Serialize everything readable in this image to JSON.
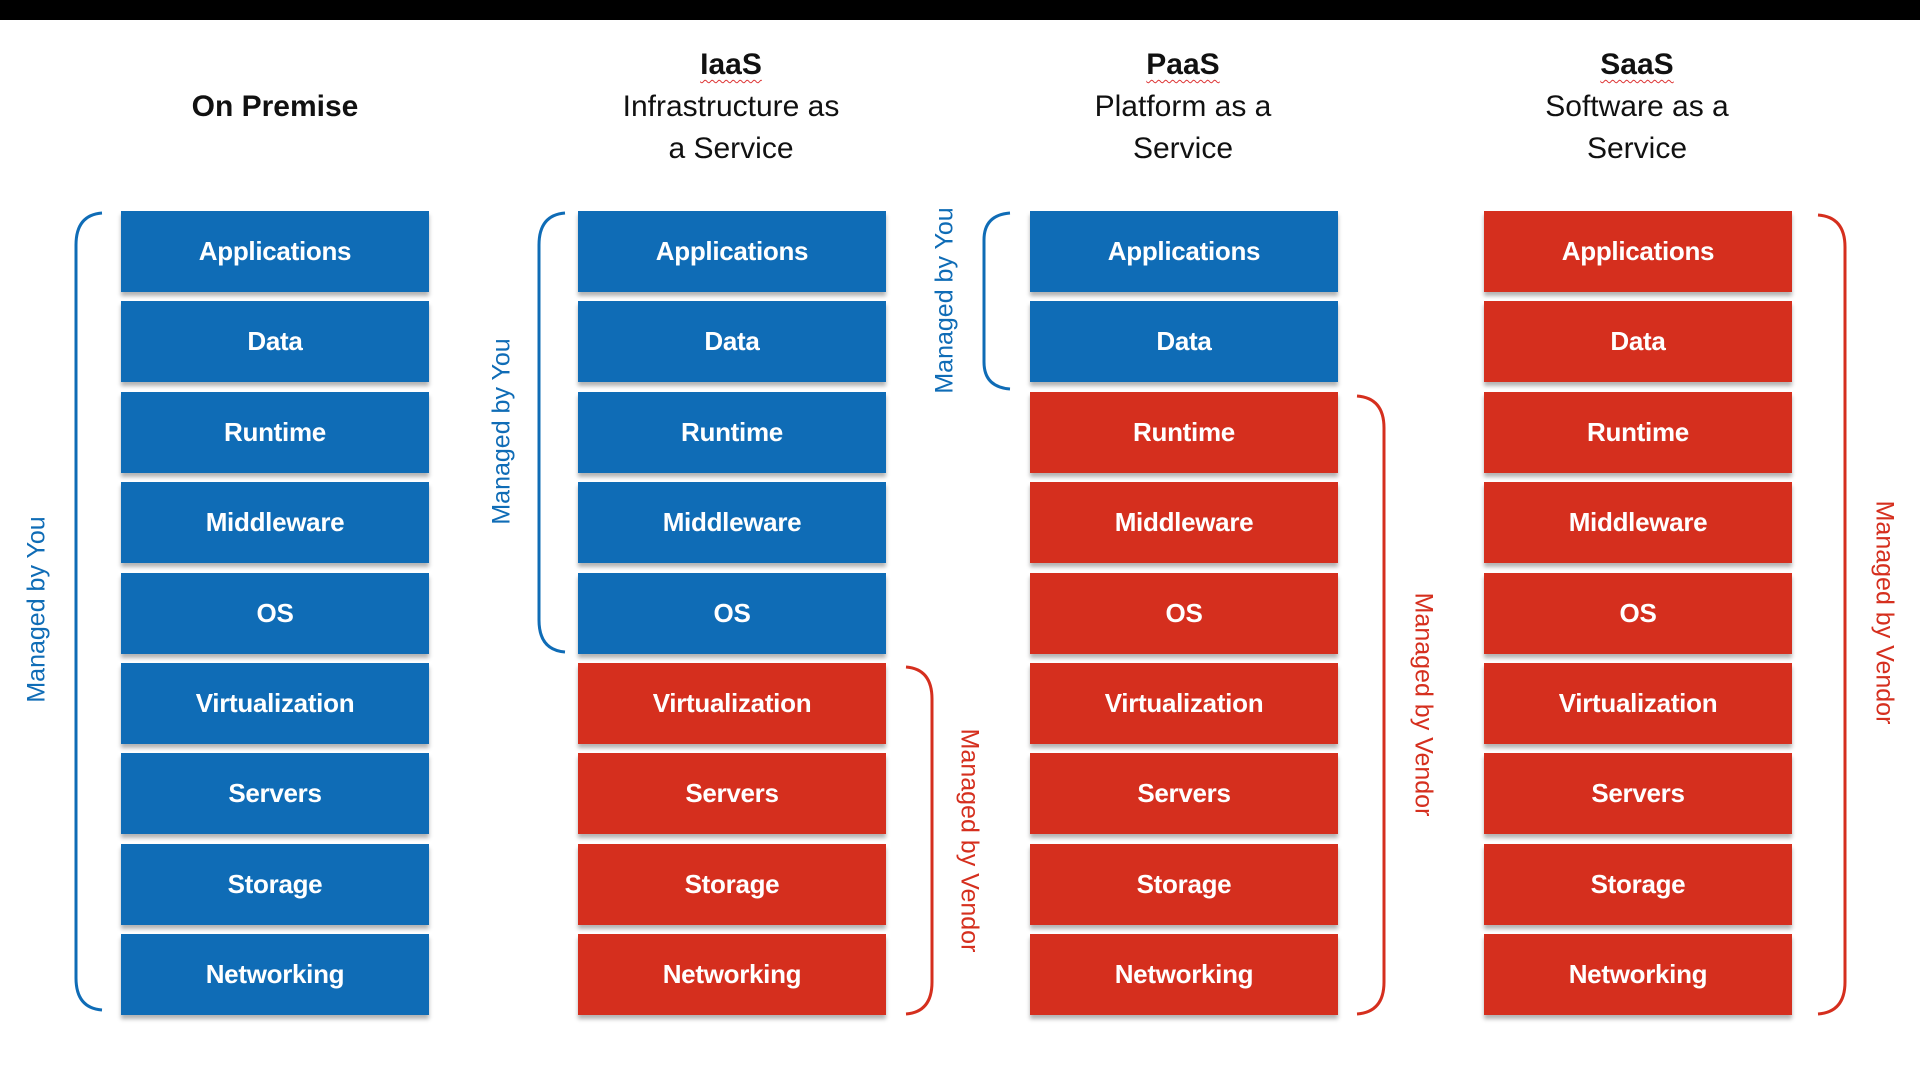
{
  "colors": {
    "you": "#0f6cb6",
    "vendor": "#d52f1e"
  },
  "managed_by_you": "Managed by You",
  "managed_by_vendor": "Managed by Vendor",
  "columns": [
    {
      "title": "On Premise",
      "abbr": "",
      "line1": "",
      "line2": "",
      "layers": [
        {
          "label": "Applications",
          "managed": "you"
        },
        {
          "label": "Data",
          "managed": "you"
        },
        {
          "label": "Runtime",
          "managed": "you"
        },
        {
          "label": "Middleware",
          "managed": "you"
        },
        {
          "label": "OS",
          "managed": "you"
        },
        {
          "label": "Virtualization",
          "managed": "you"
        },
        {
          "label": "Servers",
          "managed": "you"
        },
        {
          "label": "Storage",
          "managed": "you"
        },
        {
          "label": "Networking",
          "managed": "you"
        }
      ]
    },
    {
      "title": "",
      "abbr": "IaaS",
      "line1": "Infrastructure as",
      "line2": "a Service",
      "layers": [
        {
          "label": "Applications",
          "managed": "you"
        },
        {
          "label": "Data",
          "managed": "you"
        },
        {
          "label": "Runtime",
          "managed": "you"
        },
        {
          "label": "Middleware",
          "managed": "you"
        },
        {
          "label": "OS",
          "managed": "you"
        },
        {
          "label": "Virtualization",
          "managed": "vendor"
        },
        {
          "label": "Servers",
          "managed": "vendor"
        },
        {
          "label": "Storage",
          "managed": "vendor"
        },
        {
          "label": "Networking",
          "managed": "vendor"
        }
      ]
    },
    {
      "title": "",
      "abbr": "PaaS",
      "line1": "Platform as a",
      "line2": "Service",
      "layers": [
        {
          "label": "Applications",
          "managed": "you"
        },
        {
          "label": "Data",
          "managed": "you"
        },
        {
          "label": "Runtime",
          "managed": "vendor"
        },
        {
          "label": "Middleware",
          "managed": "vendor"
        },
        {
          "label": "OS",
          "managed": "vendor"
        },
        {
          "label": "Virtualization",
          "managed": "vendor"
        },
        {
          "label": "Servers",
          "managed": "vendor"
        },
        {
          "label": "Storage",
          "managed": "vendor"
        },
        {
          "label": "Networking",
          "managed": "vendor"
        }
      ]
    },
    {
      "title": "",
      "abbr": "SaaS",
      "line1": "Software as a",
      "line2": "Service",
      "layers": [
        {
          "label": "Applications",
          "managed": "vendor"
        },
        {
          "label": "Data",
          "managed": "vendor"
        },
        {
          "label": "Runtime",
          "managed": "vendor"
        },
        {
          "label": "Middleware",
          "managed": "vendor"
        },
        {
          "label": "OS",
          "managed": "vendor"
        },
        {
          "label": "Virtualization",
          "managed": "vendor"
        },
        {
          "label": "Servers",
          "managed": "vendor"
        },
        {
          "label": "Storage",
          "managed": "vendor"
        },
        {
          "label": "Networking",
          "managed": "vendor"
        }
      ]
    }
  ]
}
